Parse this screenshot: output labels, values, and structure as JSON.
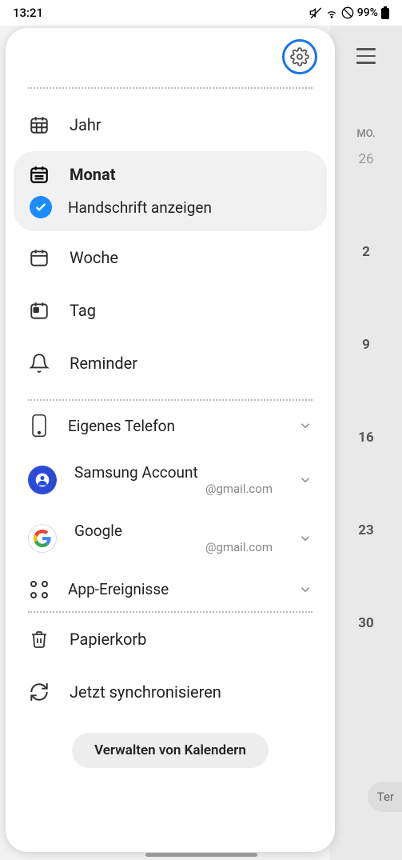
{
  "status": {
    "time": "13:21",
    "battery": "99%"
  },
  "bg": {
    "dayLabel": "MO.",
    "days": [
      "26",
      "2",
      "9",
      "16",
      "23",
      "30"
    ],
    "pill": "Ter"
  },
  "views": {
    "year": "Jahr",
    "month": "Monat",
    "handwriting": "Handschrift anzeigen",
    "week": "Woche",
    "day": "Tag",
    "reminder": "Reminder"
  },
  "accounts": {
    "phone": "Eigenes Telefon",
    "samsung": {
      "label": "Samsung Account",
      "sub": "@gmail.com"
    },
    "google": {
      "label": "Google",
      "sub": "@gmail.com"
    },
    "appEvents": "App-Ereignisse"
  },
  "actions": {
    "trash": "Papierkorb",
    "sync": "Jetzt synchronisieren",
    "manage": "Verwalten von Kalendern"
  }
}
